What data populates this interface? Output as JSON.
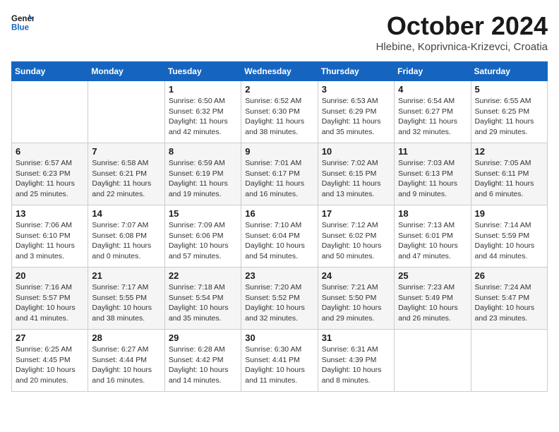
{
  "logo": {
    "line1": "General",
    "line2": "Blue"
  },
  "title": "October 2024",
  "location": "Hlebine, Koprivnica-Krizevci, Croatia",
  "days_of_week": [
    "Sunday",
    "Monday",
    "Tuesday",
    "Wednesday",
    "Thursday",
    "Friday",
    "Saturday"
  ],
  "weeks": [
    [
      {
        "day": "",
        "info": ""
      },
      {
        "day": "",
        "info": ""
      },
      {
        "day": "1",
        "info": "Sunrise: 6:50 AM\nSunset: 6:32 PM\nDaylight: 11 hours and 42 minutes."
      },
      {
        "day": "2",
        "info": "Sunrise: 6:52 AM\nSunset: 6:30 PM\nDaylight: 11 hours and 38 minutes."
      },
      {
        "day": "3",
        "info": "Sunrise: 6:53 AM\nSunset: 6:29 PM\nDaylight: 11 hours and 35 minutes."
      },
      {
        "day": "4",
        "info": "Sunrise: 6:54 AM\nSunset: 6:27 PM\nDaylight: 11 hours and 32 minutes."
      },
      {
        "day": "5",
        "info": "Sunrise: 6:55 AM\nSunset: 6:25 PM\nDaylight: 11 hours and 29 minutes."
      }
    ],
    [
      {
        "day": "6",
        "info": "Sunrise: 6:57 AM\nSunset: 6:23 PM\nDaylight: 11 hours and 25 minutes."
      },
      {
        "day": "7",
        "info": "Sunrise: 6:58 AM\nSunset: 6:21 PM\nDaylight: 11 hours and 22 minutes."
      },
      {
        "day": "8",
        "info": "Sunrise: 6:59 AM\nSunset: 6:19 PM\nDaylight: 11 hours and 19 minutes."
      },
      {
        "day": "9",
        "info": "Sunrise: 7:01 AM\nSunset: 6:17 PM\nDaylight: 11 hours and 16 minutes."
      },
      {
        "day": "10",
        "info": "Sunrise: 7:02 AM\nSunset: 6:15 PM\nDaylight: 11 hours and 13 minutes."
      },
      {
        "day": "11",
        "info": "Sunrise: 7:03 AM\nSunset: 6:13 PM\nDaylight: 11 hours and 9 minutes."
      },
      {
        "day": "12",
        "info": "Sunrise: 7:05 AM\nSunset: 6:11 PM\nDaylight: 11 hours and 6 minutes."
      }
    ],
    [
      {
        "day": "13",
        "info": "Sunrise: 7:06 AM\nSunset: 6:10 PM\nDaylight: 11 hours and 3 minutes."
      },
      {
        "day": "14",
        "info": "Sunrise: 7:07 AM\nSunset: 6:08 PM\nDaylight: 11 hours and 0 minutes."
      },
      {
        "day": "15",
        "info": "Sunrise: 7:09 AM\nSunset: 6:06 PM\nDaylight: 10 hours and 57 minutes."
      },
      {
        "day": "16",
        "info": "Sunrise: 7:10 AM\nSunset: 6:04 PM\nDaylight: 10 hours and 54 minutes."
      },
      {
        "day": "17",
        "info": "Sunrise: 7:12 AM\nSunset: 6:02 PM\nDaylight: 10 hours and 50 minutes."
      },
      {
        "day": "18",
        "info": "Sunrise: 7:13 AM\nSunset: 6:01 PM\nDaylight: 10 hours and 47 minutes."
      },
      {
        "day": "19",
        "info": "Sunrise: 7:14 AM\nSunset: 5:59 PM\nDaylight: 10 hours and 44 minutes."
      }
    ],
    [
      {
        "day": "20",
        "info": "Sunrise: 7:16 AM\nSunset: 5:57 PM\nDaylight: 10 hours and 41 minutes."
      },
      {
        "day": "21",
        "info": "Sunrise: 7:17 AM\nSunset: 5:55 PM\nDaylight: 10 hours and 38 minutes."
      },
      {
        "day": "22",
        "info": "Sunrise: 7:18 AM\nSunset: 5:54 PM\nDaylight: 10 hours and 35 minutes."
      },
      {
        "day": "23",
        "info": "Sunrise: 7:20 AM\nSunset: 5:52 PM\nDaylight: 10 hours and 32 minutes."
      },
      {
        "day": "24",
        "info": "Sunrise: 7:21 AM\nSunset: 5:50 PM\nDaylight: 10 hours and 29 minutes."
      },
      {
        "day": "25",
        "info": "Sunrise: 7:23 AM\nSunset: 5:49 PM\nDaylight: 10 hours and 26 minutes."
      },
      {
        "day": "26",
        "info": "Sunrise: 7:24 AM\nSunset: 5:47 PM\nDaylight: 10 hours and 23 minutes."
      }
    ],
    [
      {
        "day": "27",
        "info": "Sunrise: 6:25 AM\nSunset: 4:45 PM\nDaylight: 10 hours and 20 minutes."
      },
      {
        "day": "28",
        "info": "Sunrise: 6:27 AM\nSunset: 4:44 PM\nDaylight: 10 hours and 16 minutes."
      },
      {
        "day": "29",
        "info": "Sunrise: 6:28 AM\nSunset: 4:42 PM\nDaylight: 10 hours and 14 minutes."
      },
      {
        "day": "30",
        "info": "Sunrise: 6:30 AM\nSunset: 4:41 PM\nDaylight: 10 hours and 11 minutes."
      },
      {
        "day": "31",
        "info": "Sunrise: 6:31 AM\nSunset: 4:39 PM\nDaylight: 10 hours and 8 minutes."
      },
      {
        "day": "",
        "info": ""
      },
      {
        "day": "",
        "info": ""
      }
    ]
  ]
}
